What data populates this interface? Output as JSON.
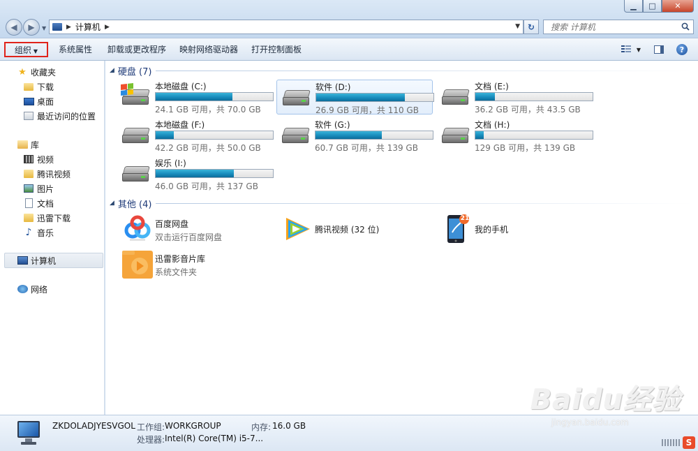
{
  "window": {
    "minimize_label": "▁",
    "maximize_label": "□",
    "close_label": "✕"
  },
  "address": {
    "crumb": "计算机",
    "search_placeholder": "搜索 计算机"
  },
  "toolbar": {
    "organize": "组织",
    "system_properties": "系统属性",
    "uninstall": "卸载或更改程序",
    "map_drive": "映射网络驱动器",
    "control_panel": "打开控制面板"
  },
  "sidebar": {
    "favorites": "收藏夹",
    "downloads": "下载",
    "desktop": "桌面",
    "recent": "最近访问的位置",
    "libraries": "库",
    "videos": "视频",
    "tencent_video": "腾讯视频",
    "pictures": "图片",
    "documents": "文档",
    "thunder": "迅雷下载",
    "music": "音乐",
    "computer": "计算机",
    "network": "网络"
  },
  "groups": {
    "hdd": "硬盘 (7)",
    "other": "其他 (4)"
  },
  "drives": [
    {
      "name": "本地磁盘 (C:)",
      "info": "24.1 GB 可用，共 70.0 GB",
      "used_fraction": 0.656
    },
    {
      "name": "软件 (D:)",
      "info": "26.9 GB 可用，共 110 GB",
      "used_fraction": 0.755
    },
    {
      "name": "文档 (E:)",
      "info": "36.2 GB 可用，共 43.5 GB",
      "used_fraction": 0.168
    },
    {
      "name": "本地磁盘 (F:)",
      "info": "42.2 GB 可用，共 50.0 GB",
      "used_fraction": 0.156
    },
    {
      "name": "软件 (G:)",
      "info": "60.7 GB 可用，共 139 GB",
      "used_fraction": 0.563
    },
    {
      "name": "文档 (H:)",
      "info": "129 GB 可用，共 139 GB",
      "used_fraction": 0.072
    },
    {
      "name": "娱乐 (I:)",
      "info": "46.0 GB 可用，共 137 GB",
      "used_fraction": 0.664
    }
  ],
  "others": [
    {
      "name": "百度网盘",
      "sub": "双击运行百度网盘"
    },
    {
      "name": "腾讯视频 (32 位)",
      "sub": ""
    },
    {
      "name": "我的手机",
      "sub": "",
      "badge": "21"
    },
    {
      "name": "迅雷影音片库",
      "sub": "系统文件夹"
    }
  ],
  "details": {
    "computer_name": "ZKDOLADJYESVGOL",
    "workgroup_label": "工作组:",
    "workgroup": "WORKGROUP",
    "memory_label": "内存:",
    "memory": "16.0 GB",
    "processor_label": "处理器:",
    "processor": "Intel(R) Core(TM) i5-7..."
  },
  "watermark": {
    "main": "Baidu经验",
    "sub": "jingyan.baidu.com"
  },
  "colors": {
    "drive_fill": "#1b8fbf",
    "organize_highlight": "#e0231a",
    "group_title": "#1e3a78"
  }
}
